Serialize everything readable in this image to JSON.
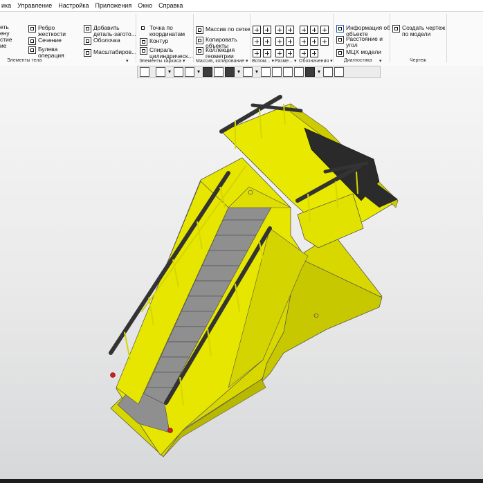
{
  "menu": [
    "ика",
    "Управление",
    "Настройка",
    "Приложения",
    "Окно",
    "Справка"
  ],
  "ribbon": {
    "col1": [
      "еть",
      "ену",
      "стие",
      "ие"
    ],
    "tools": [
      {
        "label": "Ребро\nжесткости",
        "icon": "rib-icon"
      },
      {
        "label": "Сечение",
        "icon": "section-icon"
      },
      {
        "label": "Булева\nоперация",
        "icon": "boolean-icon"
      },
      {
        "label": "Добавить\nдеталь-загото...",
        "icon": "add-part-icon"
      },
      {
        "label": "Оболочка",
        "icon": "shell-icon"
      },
      {
        "label": "Масштабиров...",
        "icon": "scale-icon"
      },
      {
        "label": "Точка по\nкоординатам",
        "icon": "point-icon"
      },
      {
        "label": "Контур",
        "icon": "contour-icon"
      },
      {
        "label": "Спираль\nцилиндрическ...",
        "icon": "spiral-icon"
      },
      {
        "label": "Массив по сетке",
        "icon": "grid-array-icon"
      },
      {
        "label": "Копировать\nобъекты",
        "icon": "copy-objects-icon"
      },
      {
        "label": "Коллекция\nгеометрии",
        "icon": "geometry-collection-icon"
      },
      {
        "label": "Информация об\nобъекте",
        "icon": "object-info-icon"
      },
      {
        "label": "Расстояние и\nугол",
        "icon": "distance-angle-icon"
      },
      {
        "label": "МЦХ модели",
        "icon": "mass-properties-icon"
      },
      {
        "label": "Создать чертеж\nпо модели",
        "icon": "create-drawing-icon"
      }
    ],
    "groups": [
      "Элементы тела",
      "Элементы каркаса",
      "Массив, копирование",
      "Вспом...",
      "Разме...",
      "Обозначения",
      "Диагностика",
      "Чертеж"
    ]
  },
  "colors": {
    "accent": "#1f5fb5",
    "body_yellow": "#e6e600",
    "step_gray": "#8c8c8c",
    "rail_dark": "#3a3a3a"
  }
}
